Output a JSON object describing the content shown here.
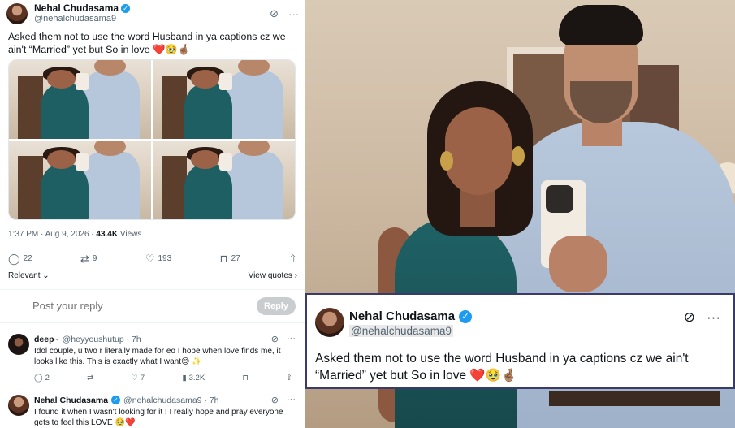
{
  "tweet": {
    "author_name": "Nehal Chudasama",
    "handle": "@nehalchudasama9",
    "text": "Asked them not to use the word Husband in ya captions cz we ain't “Married” yet but So in love",
    "emojis": "❤️🥹🤞🏽",
    "timestamp": "1:37 PM · Aug 9, 2026 · ",
    "views_count": "43.4K",
    "views_label": " Views",
    "replies": "22",
    "reposts": "9",
    "likes": "193",
    "bookmarks": "27",
    "relevant_label": "Relevant ⌄",
    "view_quotes_label": "View quotes ›"
  },
  "reply_box": {
    "placeholder": "Post your reply",
    "button_label": "Reply"
  },
  "replies": [
    {
      "name": "deep~",
      "handle": "@heyyoushutup · 7h",
      "text": "Idol couple, u two r literally made for eo I hope when love finds me, it looks like this. This is exactly what I want😊 ✨",
      "replies": "2",
      "likes": "7",
      "views": "3.2K"
    },
    {
      "name": "Nehal Chudasama",
      "handle": "@nehalchudasama9 · 7h",
      "text": "I found it when I wasn't looking for it ! I really hope and pray everyone gets to feel this LOVE 🥹❤️"
    }
  ],
  "card": {
    "name": "Nehal Chudasama",
    "handle": "@nehalchudasama9",
    "text": "Asked them not to use the word Husband in ya captions cz we ain't “Married” yet but So in love",
    "emojis": "❤️🥹🤞🏽"
  },
  "icons": {
    "verified": "verified-badge-icon",
    "grok": "grok-icon",
    "more": "more-icon",
    "reply": "reply-icon",
    "repost": "repost-icon",
    "like": "like-icon",
    "bookmark": "bookmark-icon",
    "share": "share-icon",
    "views": "views-icon"
  },
  "colors": {
    "accent": "#1d9bf0",
    "heart": "#e0245e",
    "muted": "#536471",
    "reply_button": "#c9cdd0"
  }
}
